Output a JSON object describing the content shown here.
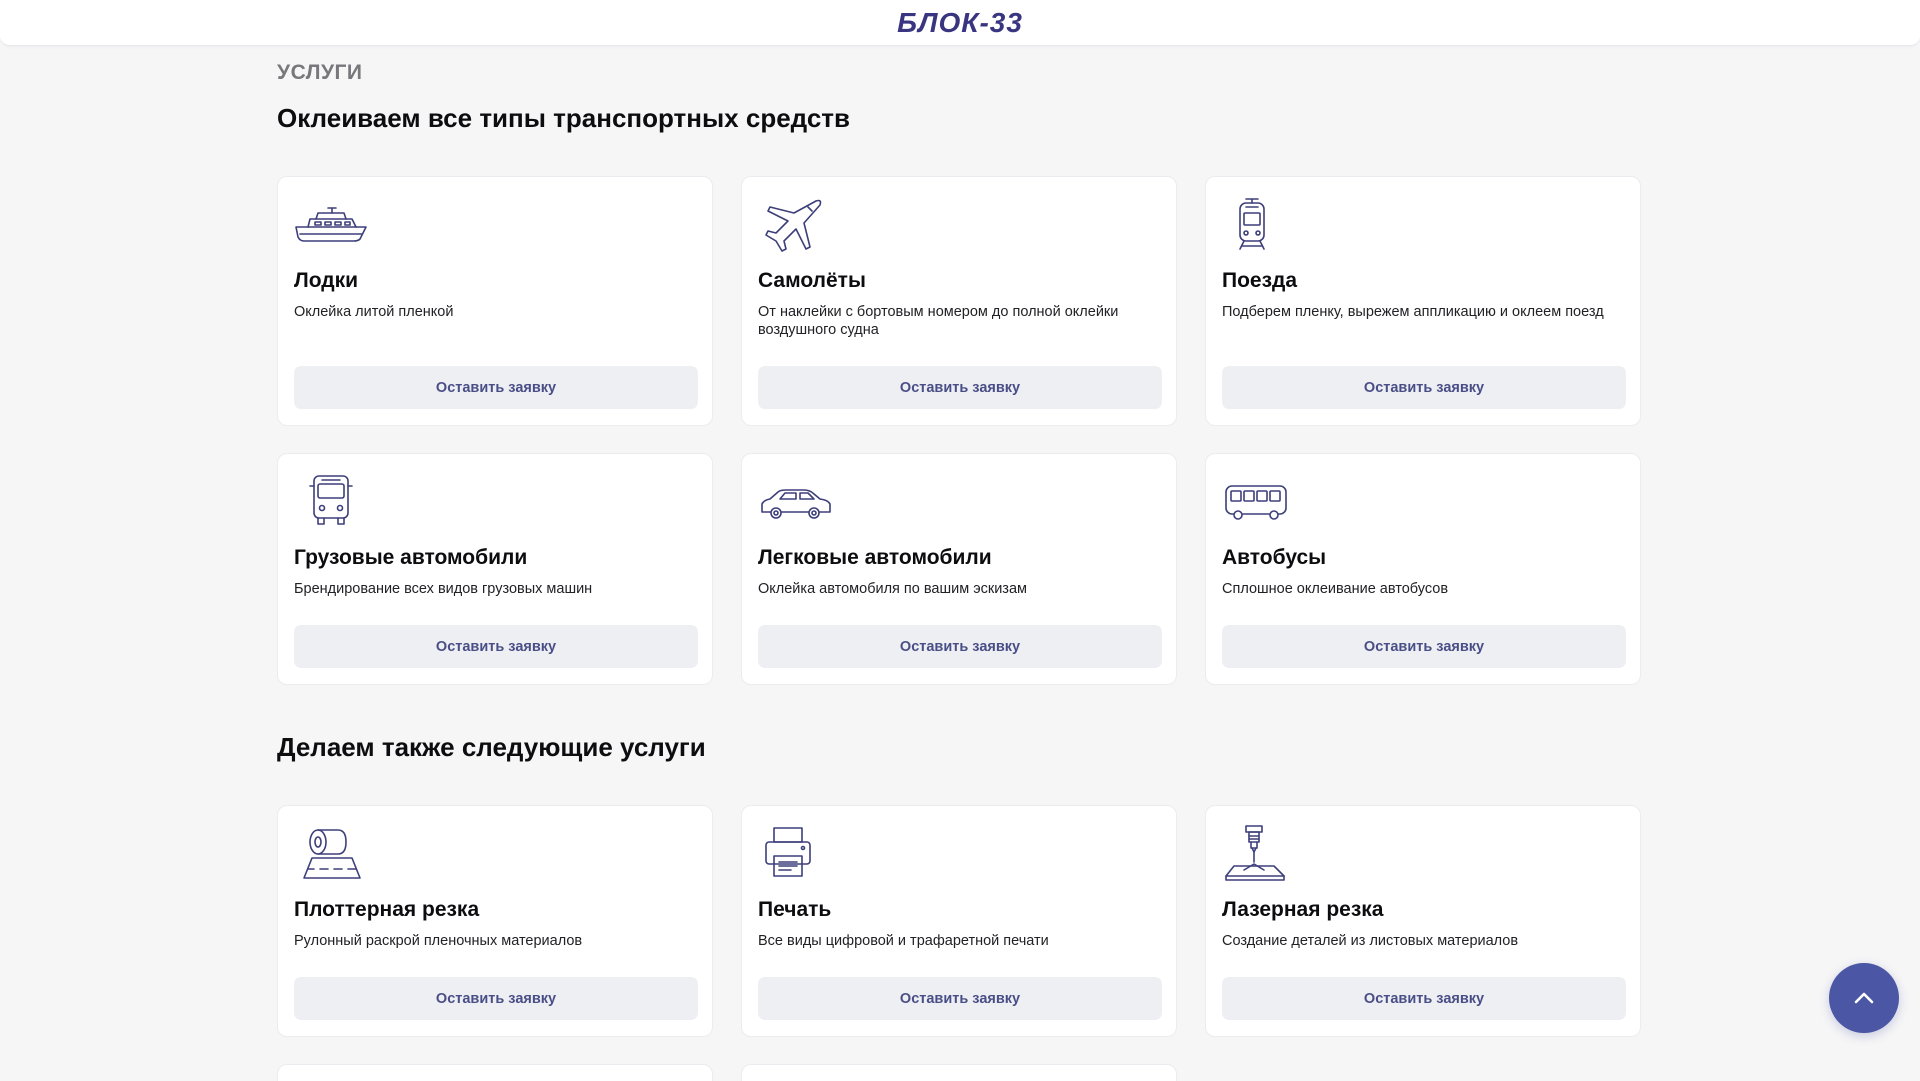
{
  "header": {
    "logo_text": "БЛОК-33"
  },
  "section": {
    "eyebrow": "УСЛУГИ",
    "title": "Оклеиваем все типы транспортных средств",
    "cards": [
      {
        "icon": "boat-icon",
        "title": "Лодки",
        "text": "Оклейка литой пленкой",
        "button": "Оставить заявку"
      },
      {
        "icon": "airplane-icon",
        "title": "Самолёты",
        "text": "От наклейки с бортовым номером до полной оклейки воздушного судна",
        "button": "Оставить заявку"
      },
      {
        "icon": "train-icon",
        "title": "Поезда",
        "text": "Подберем пленку, вырежем аппликацию и оклеем поезд",
        "button": "Оставить заявку"
      },
      {
        "icon": "truck-icon",
        "title": "Грузовые автомобили",
        "text": "Брендирование всех видов грузовых машин",
        "button": "Оставить заявку"
      },
      {
        "icon": "car-icon",
        "title": "Легковые автомобили",
        "text": "Оклейка автомобиля по вашим эскизам",
        "button": "Оставить заявку"
      },
      {
        "icon": "bus-icon",
        "title": "Автобусы",
        "text": "Сплошное оклеивание автобусов",
        "button": "Оставить заявку"
      }
    ]
  },
  "extra": {
    "title": "Делаем также следующие услуги",
    "cards": [
      {
        "icon": "film-roll-icon",
        "title": "Плоттерная резка",
        "text": "Рулонный раскрой пленочных материалов",
        "button": "Оставить заявку"
      },
      {
        "icon": "printer-icon",
        "title": "Печать",
        "text": "Все виды цифровой и трафаретной печати",
        "button": "Оставить заявку"
      },
      {
        "icon": "laser-cutter-icon",
        "title": "Лазерная резка",
        "text": "Создание деталей из листовых материалов",
        "button": "Оставить заявку"
      }
    ]
  },
  "colors": {
    "background": "#f6f6f7",
    "brand": "#3a3580",
    "button_bg": "#eeeff3",
    "button_text": "#4a4e86",
    "scroll_button": "#4b56a5"
  },
  "scroll_top_icon": "chevron-up-icon"
}
